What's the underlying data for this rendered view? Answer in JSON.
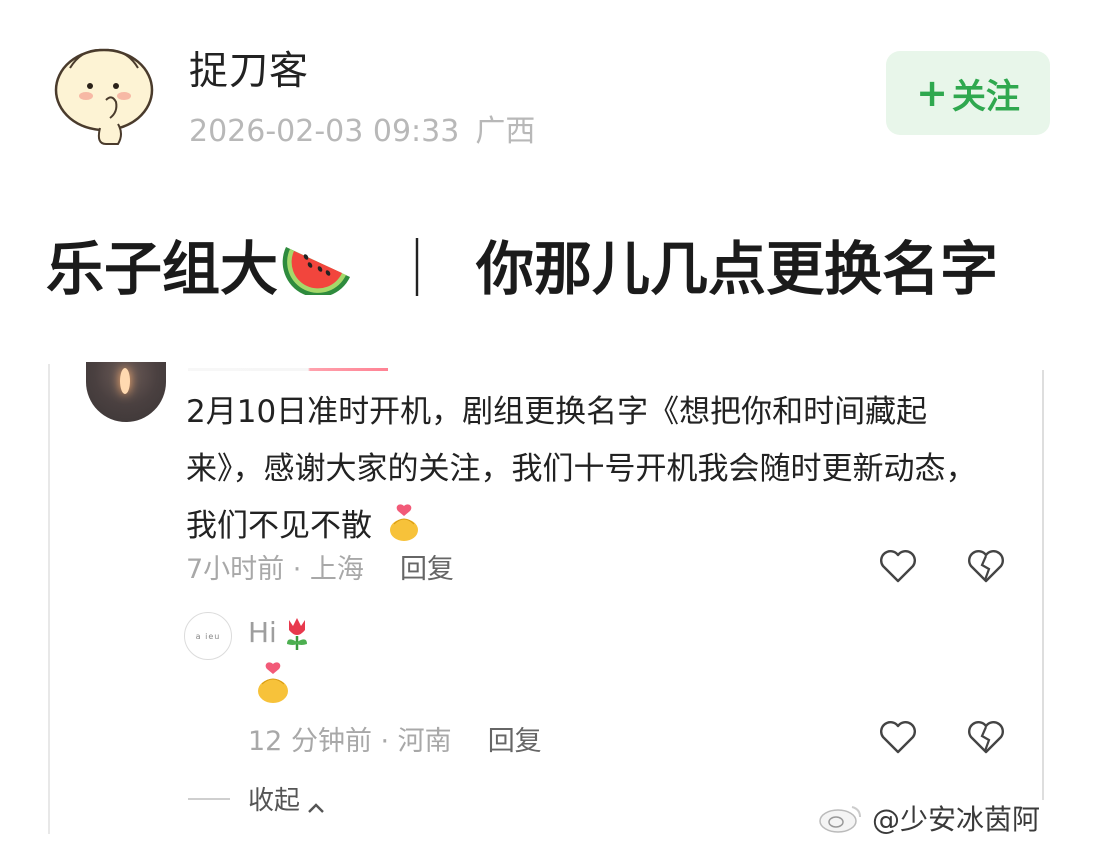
{
  "post": {
    "username": "捉刀客",
    "datetime": "2026-02-03 09:33",
    "location": "广西",
    "follow_label": "+ 关注",
    "follow_plus": "+",
    "follow_text": "关注",
    "title_left": "乐子组大",
    "title_separator": "｜",
    "title_right": "你那儿几点更换名字"
  },
  "comment": {
    "text": "2月10日准时开机，剧组更换名字《想把你和时间藏起来》，感谢大家的关注，我们十号开机我会随时更新动态，我们不见不散",
    "time": "7小时前",
    "location": "上海",
    "meta": "7小时前 · 上海",
    "reply_label": "回复"
  },
  "reply": {
    "text": "Hi",
    "avatar_text": "a ieu",
    "time": "12 分钟前",
    "location": "河南",
    "meta": "12 分钟前 · 河南",
    "reply_label": "回复"
  },
  "collapse_label": "收起",
  "watermark": "@少安冰茵阿",
  "icons": {
    "avatar": "cartoon-bun-avatar",
    "title_emoji": "watermelon-icon",
    "like": "heart-outline-icon",
    "dislike": "broken-heart-icon",
    "reply_emoji": "tulip-icon",
    "heart_hands": "heart-hands-emoji",
    "chevron": "chevron-up-icon",
    "logo": "weibo-logo-icon"
  },
  "colors": {
    "follow_bg": "#e8f6ea",
    "follow_text": "#2fa84f",
    "meta_gray": "#b8b8b8"
  }
}
